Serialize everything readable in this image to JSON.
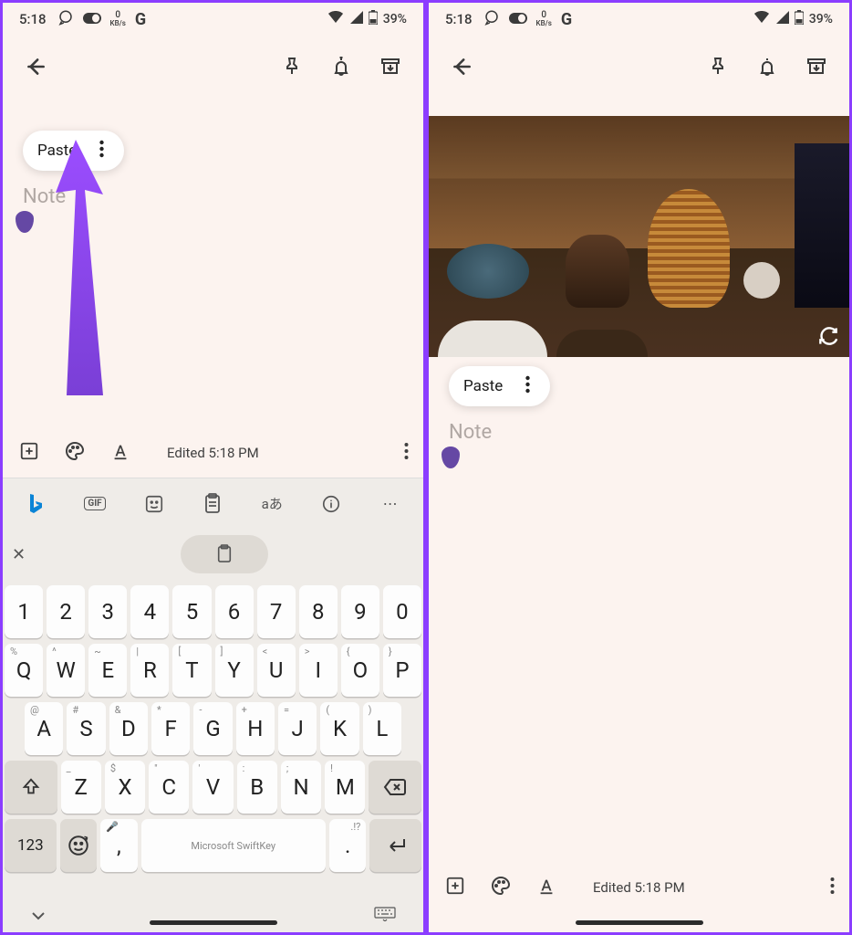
{
  "status": {
    "time": "5:18",
    "data_label": "0",
    "data_unit": "KB/s",
    "battery": "39%"
  },
  "paste": {
    "label": "Paste"
  },
  "note": {
    "placeholder": "Note"
  },
  "bottom": {
    "edited": "Edited 5:18 PM"
  },
  "kb": {
    "gif": "GIF",
    "lang": "aあ",
    "num123": "123",
    "space": "Microsoft SwiftKey",
    "row1": [
      "1",
      "2",
      "3",
      "4",
      "5",
      "6",
      "7",
      "8",
      "9",
      "0"
    ],
    "row2": [
      "Q",
      "W",
      "E",
      "R",
      "T",
      "Y",
      "U",
      "I",
      "O",
      "P"
    ],
    "row2sup": [
      "%",
      "^",
      "~",
      "|",
      "[",
      "]",
      "<",
      ">",
      "{",
      "}"
    ],
    "row3": [
      "A",
      "S",
      "D",
      "F",
      "G",
      "H",
      "J",
      "K",
      "L"
    ],
    "row3sup": [
      "@",
      "#",
      "&",
      "*",
      "-",
      "+",
      "=",
      "(",
      ")"
    ],
    "row4": [
      "Z",
      "X",
      "C",
      "V",
      "B",
      "N",
      "M"
    ],
    "row4sup": [
      "_",
      "$",
      "\"",
      "'",
      ":",
      ";",
      "! "
    ]
  }
}
